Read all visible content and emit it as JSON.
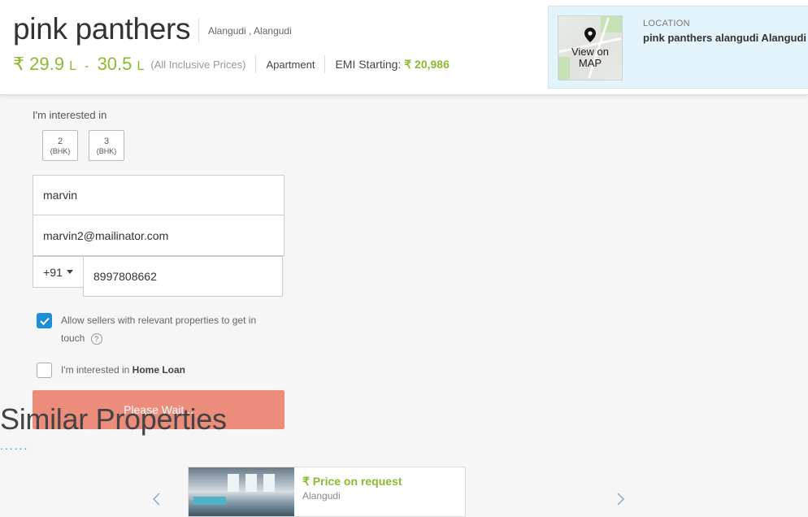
{
  "header": {
    "title": "pink panthers",
    "location_small": "Alangudi , Alangudi",
    "price": {
      "currency": "₹",
      "min": "29.9",
      "min_unit": "L",
      "separator": "-",
      "max": "30.5",
      "max_unit": "L",
      "note": "(All Inclusive Prices)"
    },
    "property_type": "Apartment",
    "emi_label": "EMI Starting:",
    "emi_value": "₹ 20,986"
  },
  "location_box": {
    "map_label_line1": "View on",
    "map_label_line2": "MAP",
    "heading": "LOCATION",
    "address": "pink panthers alangudi Alangudi"
  },
  "form": {
    "interest_label": "I'm interested in",
    "bhk_options": [
      {
        "num": "2",
        "unit": "(BHK)"
      },
      {
        "num": "3",
        "unit": "(BHK)"
      }
    ],
    "name_value": "marvin",
    "email_value": "marvin2@mailinator.com",
    "country_code": "+91",
    "phone_value": "8997808662",
    "allow_sellers_text_line1": "Allow sellers with relevant properties to get in",
    "allow_sellers_text_line2": "touch",
    "allow_sellers_checked": true,
    "help_glyph": "?",
    "home_loan_prefix": "I'm interested in",
    "home_loan_bold": "Home Loan",
    "home_loan_checked": false,
    "submit_label": "Please Wait..."
  },
  "similar": {
    "title": "Similar Properties",
    "dots": "......",
    "card": {
      "price": "₹ Price on request",
      "location": "Alangudi"
    }
  },
  "colors": {
    "accent_green": "#8bba30",
    "checkbox_blue": "#1e8fd6",
    "button_salmon": "#ec8c7b",
    "location_bg": "#e3f4fc"
  }
}
